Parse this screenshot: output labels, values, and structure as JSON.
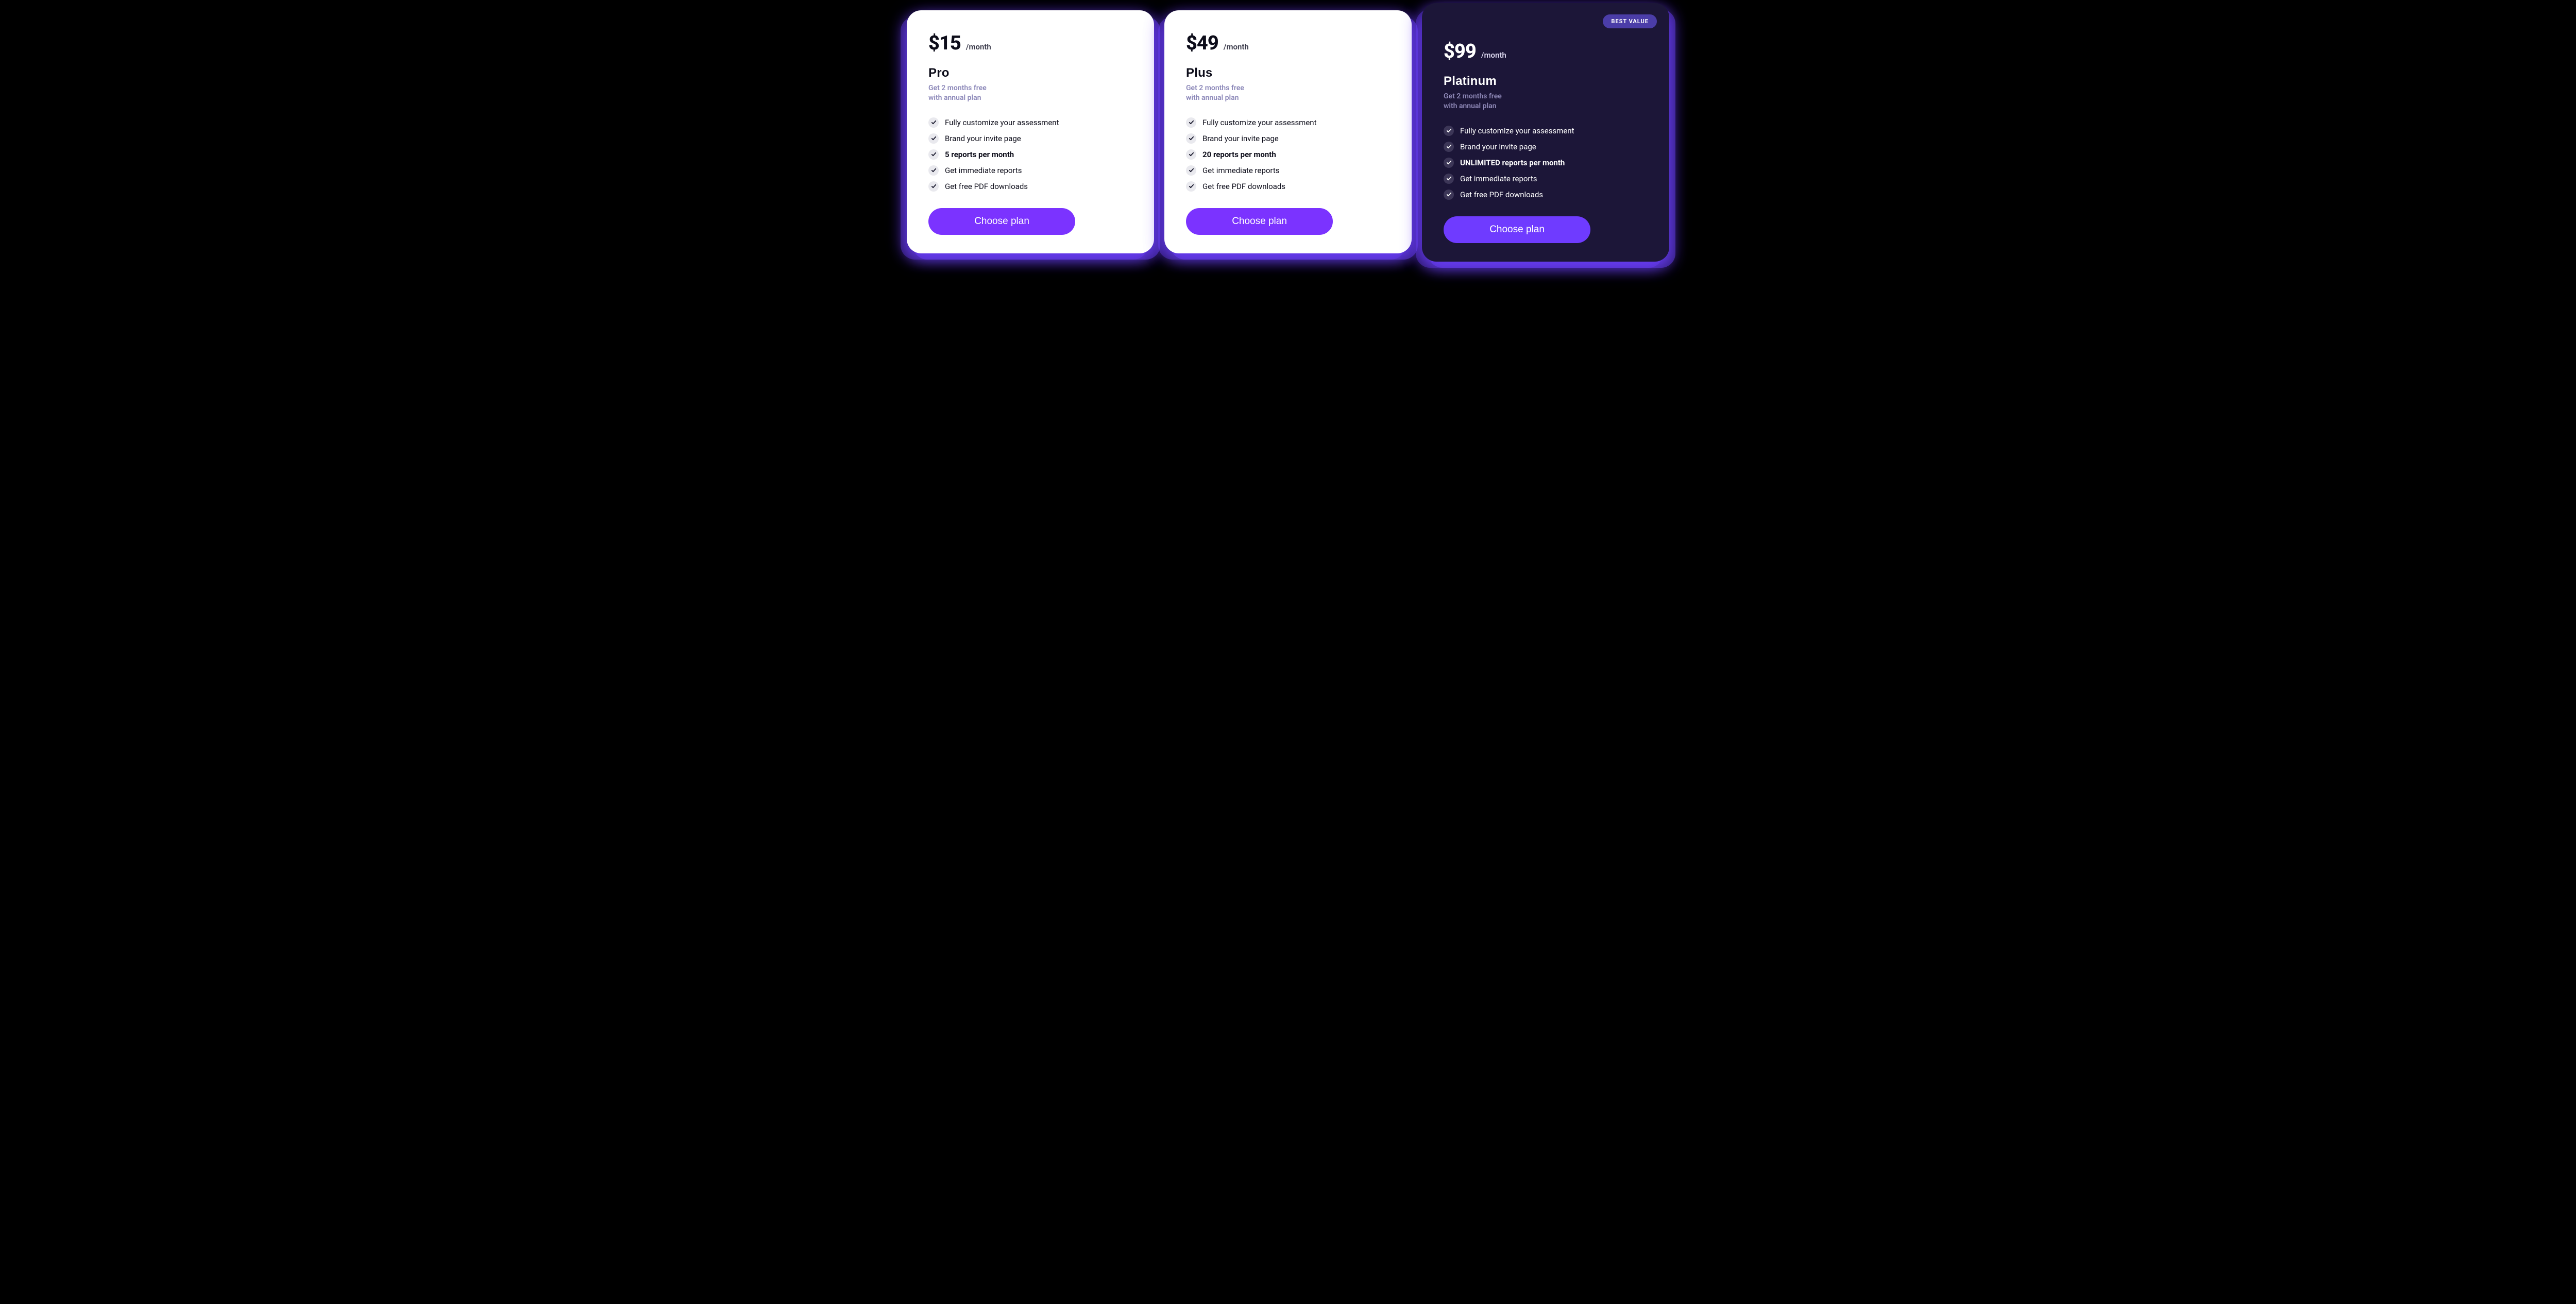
{
  "plans": [
    {
      "price": "$15",
      "period": "/month",
      "name": "Pro",
      "promo_line1": "Get 2 months free",
      "promo_line2": "with annual plan",
      "features": [
        {
          "text": "Fully customize your assessment",
          "bold": false
        },
        {
          "text": "Brand your invite page",
          "bold": false
        },
        {
          "text": "5 reports per month",
          "bold": true
        },
        {
          "text": "Get immediate reports",
          "bold": false
        },
        {
          "text": "Get free PDF downloads",
          "bold": false
        }
      ],
      "cta": "Choose plan",
      "badge": null,
      "theme": "light"
    },
    {
      "price": "$49",
      "period": "/month",
      "name": "Plus",
      "promo_line1": "Get 2 months free",
      "promo_line2": "with annual plan",
      "features": [
        {
          "text": "Fully customize your assessment",
          "bold": false
        },
        {
          "text": "Brand your invite page",
          "bold": false
        },
        {
          "text": "20 reports per month",
          "bold": true
        },
        {
          "text": "Get immediate reports",
          "bold": false
        },
        {
          "text": "Get free PDF downloads",
          "bold": false
        }
      ],
      "cta": "Choose plan",
      "badge": null,
      "theme": "light"
    },
    {
      "price": "$99",
      "period": "/month",
      "name": "Platinum",
      "promo_line1": "Get 2 months free",
      "promo_line2": "with annual plan",
      "features": [
        {
          "text": "Fully customize your assessment",
          "bold": false
        },
        {
          "text": "Brand your invite page",
          "bold": false
        },
        {
          "text": "UNLIMITED reports per month",
          "bold": true
        },
        {
          "text": "Get immediate reports",
          "bold": false
        },
        {
          "text": "Get free PDF downloads",
          "bold": false
        }
      ],
      "cta": "Choose plan",
      "badge": "BEST VALUE",
      "theme": "dark"
    }
  ]
}
